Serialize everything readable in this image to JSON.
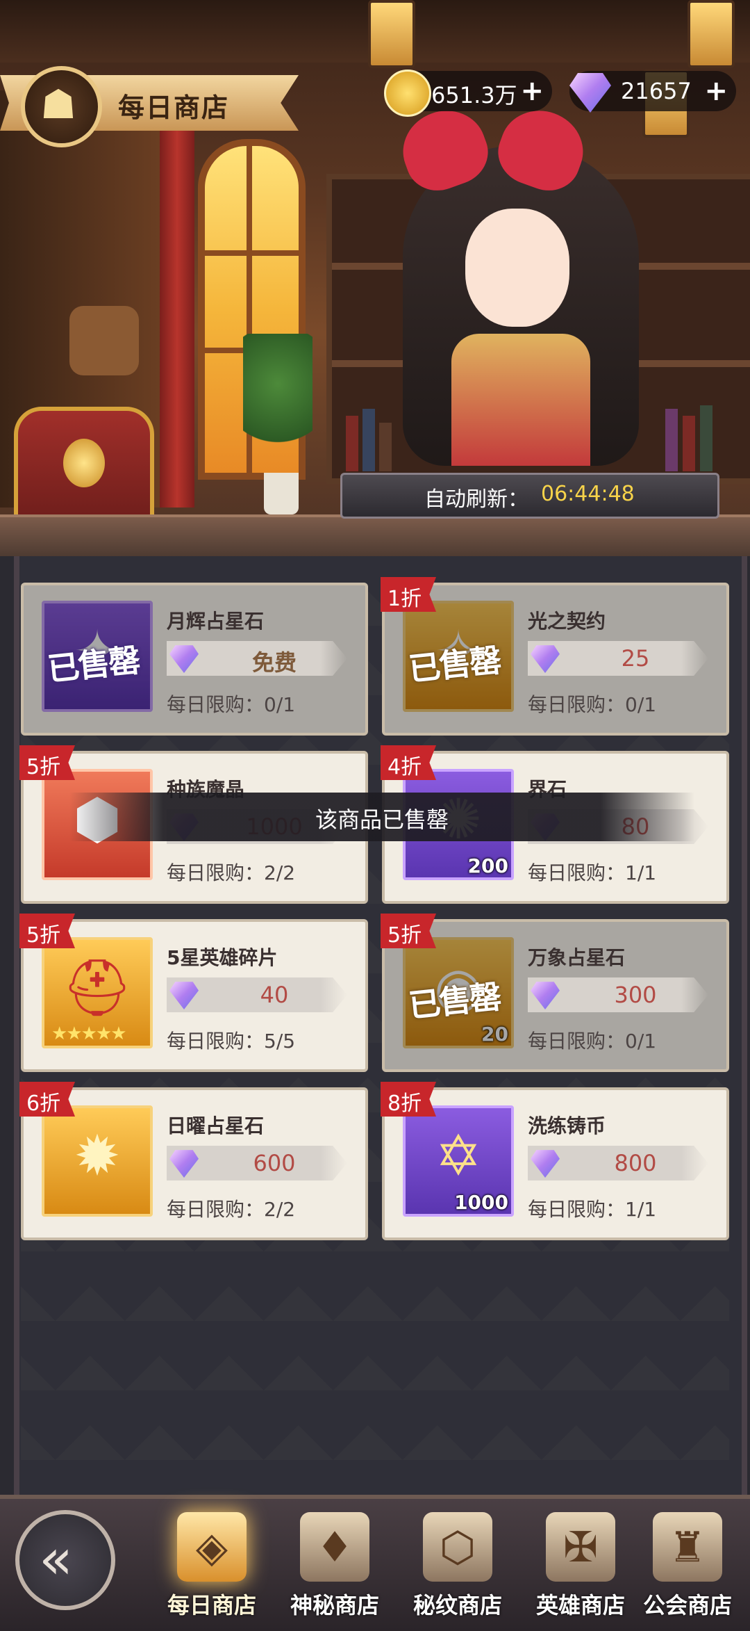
{
  "header": {
    "title": "每日商店",
    "gold": "651.3万",
    "diamonds": "21657",
    "plus": "+"
  },
  "refresh": {
    "label": "自动刷新：",
    "time": "06:44:48"
  },
  "sold_stamp": "已售罄",
  "toast": "该商品已售罄",
  "items": [
    {
      "name": "月辉占星石",
      "price": "免费",
      "limit": "每日限购：0/1",
      "discount": "",
      "count": "",
      "sold": true
    },
    {
      "name": "光之契约",
      "price": "25",
      "limit": "每日限购：0/1",
      "discount": "1折",
      "count": "",
      "sold": true
    },
    {
      "name": "种族魔晶",
      "price": "1000",
      "limit": "每日限购：2/2",
      "discount": "5折",
      "count": "",
      "sold": false
    },
    {
      "name": "界石",
      "price": "80",
      "limit": "每日限购：1/1",
      "discount": "4折",
      "count": "200",
      "sold": false
    },
    {
      "name": "5星英雄碎片",
      "price": "40",
      "limit": "每日限购：5/5",
      "discount": "5折",
      "count": "",
      "sold": false
    },
    {
      "name": "万象占星石",
      "price": "300",
      "limit": "每日限购：0/1",
      "discount": "5折",
      "count": "20",
      "sold": true
    },
    {
      "name": "日曜占星石",
      "price": "600",
      "limit": "每日限购：2/2",
      "discount": "6折",
      "count": "",
      "sold": false
    },
    {
      "name": "洗练铸币",
      "price": "800",
      "limit": "每日限购：1/1",
      "discount": "8折",
      "count": "1000",
      "sold": false
    }
  ],
  "nav": {
    "tabs": [
      {
        "label": "每日商店",
        "active": true
      },
      {
        "label": "神秘商店",
        "active": false
      },
      {
        "label": "秘纹商店",
        "active": false
      },
      {
        "label": "英雄商店",
        "active": false
      },
      {
        "label": "公会商店",
        "active": false
      }
    ]
  },
  "icons": {
    "title_emblem": "balloon-icon",
    "gold": "gold-coin-icon",
    "diamond": "diamond-icon",
    "back": "back-arrow-icon"
  },
  "colors": {
    "discount_badge": "#c8262b",
    "price_text": "#b24b45",
    "refresh_time": "#f7d34a"
  }
}
